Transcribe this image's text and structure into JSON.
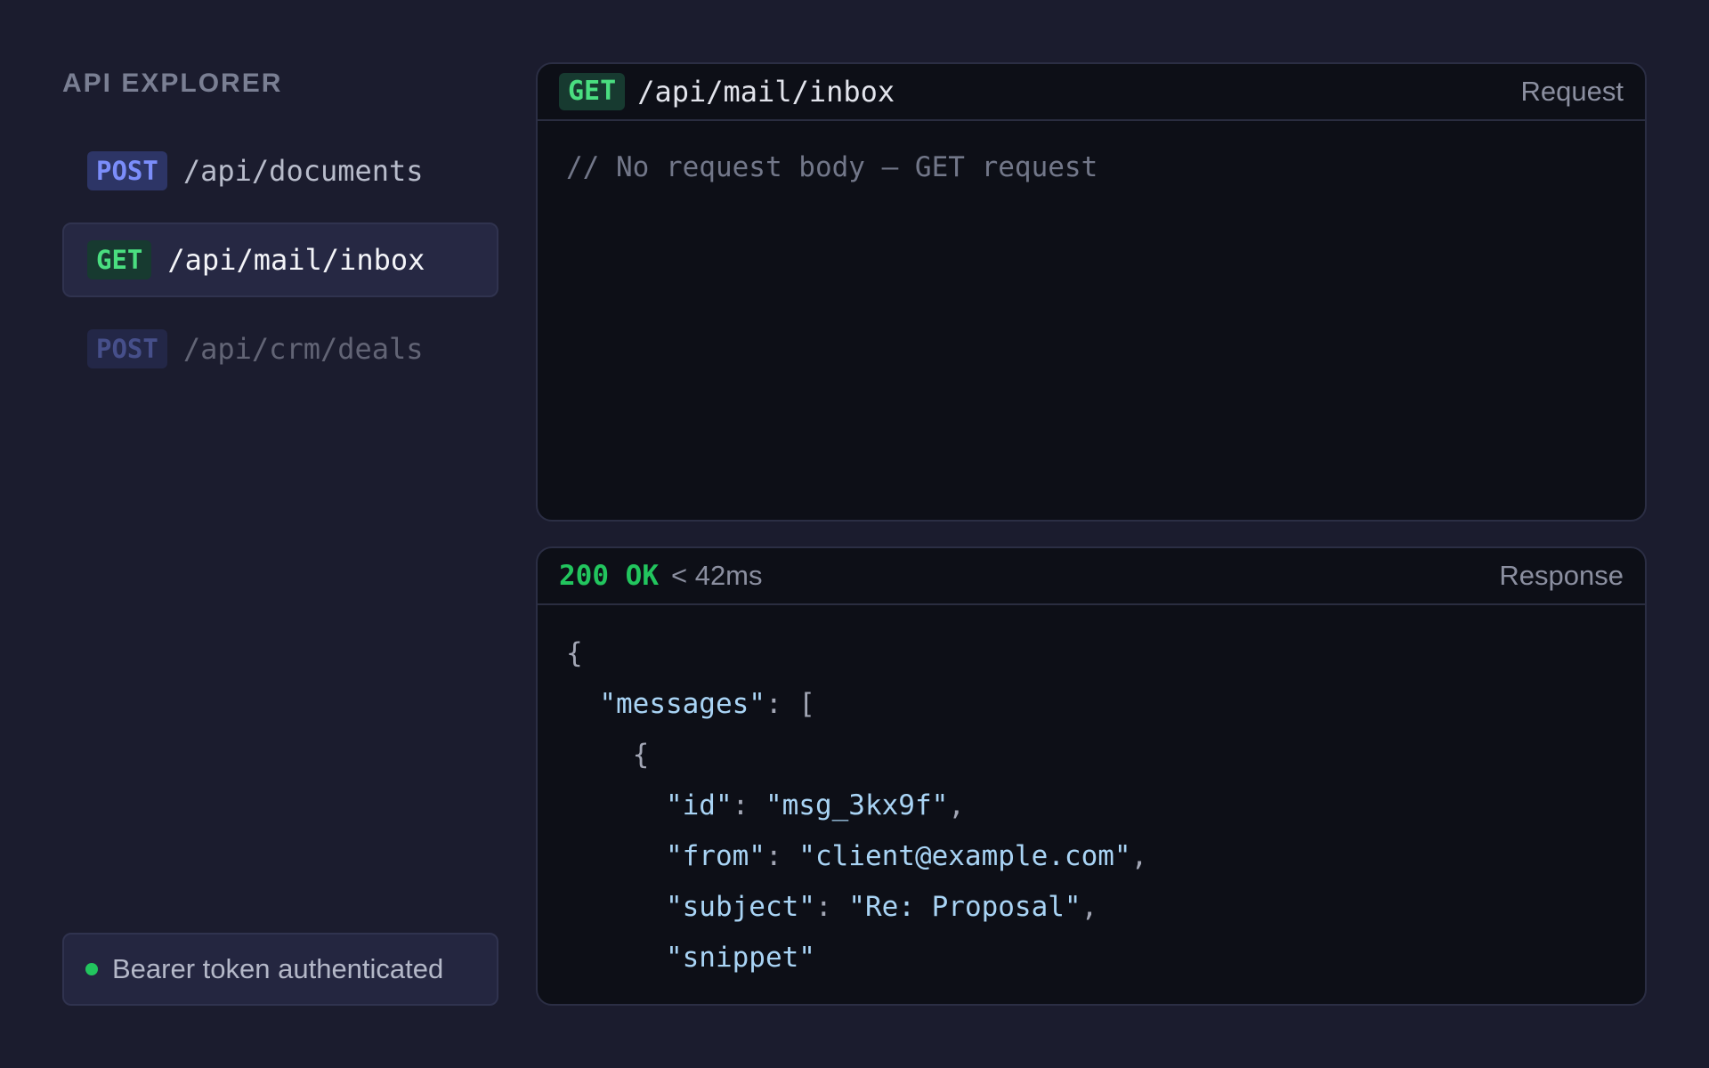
{
  "sidebar": {
    "title": "API EXPLORER",
    "endpoints": [
      {
        "method": "POST",
        "path": "/api/documents"
      },
      {
        "method": "GET",
        "path": "/api/mail/inbox"
      },
      {
        "method": "POST",
        "path": "/api/crm/deals"
      }
    ],
    "auth_status": "Bearer token authenticated"
  },
  "request": {
    "method": "GET",
    "path": "/api/mail/inbox",
    "label": "Request",
    "body_comment": "// No request body — GET request"
  },
  "response": {
    "status": "200 OK",
    "timing": "< 42ms",
    "label": "Response",
    "lines": {
      "l0": "{",
      "l1_key": "\"messages\"",
      "l1_rest": ": [",
      "l2": "{",
      "l3_key": "\"id\"",
      "l3_val": "\"msg_3kx9f\"",
      "l4_key": "\"from\"",
      "l4_val": "\"client@example.com\"",
      "l5_key": "\"subject\"",
      "l5_val": "\"Re: Proposal\"",
      "l6_key": "\"snippet\""
    }
  },
  "colors": {
    "background": "#1b1c2e",
    "get": "#4ade80",
    "post": "#7b8dfa",
    "status_ok": "#22c55e"
  }
}
